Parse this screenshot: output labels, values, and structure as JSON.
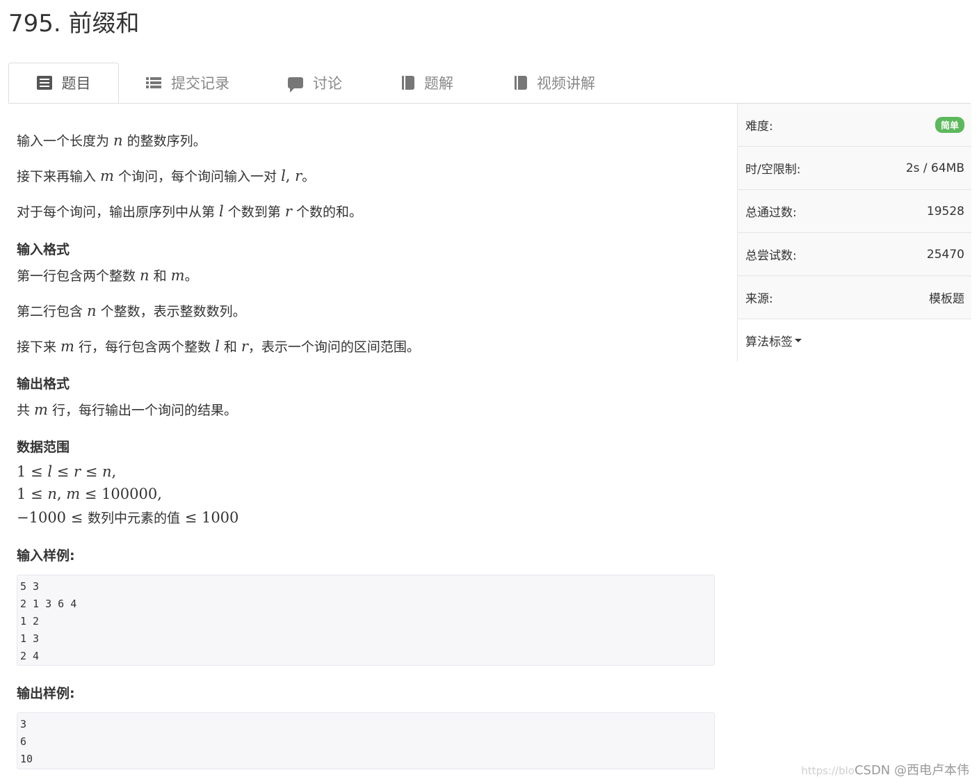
{
  "problem": {
    "title": "795. 前缀和"
  },
  "tabs": [
    {
      "label": "题目",
      "icon": "file-text-icon",
      "active": true
    },
    {
      "label": "提交记录",
      "icon": "list-icon"
    },
    {
      "label": "讨论",
      "icon": "comment-icon"
    },
    {
      "label": "题解",
      "icon": "book-icon"
    },
    {
      "label": "视频讲解",
      "icon": "book-icon"
    }
  ],
  "description": {
    "p1": {
      "a": "输入一个长度为 ",
      "v": "n",
      "b": " 的整数序列。"
    },
    "p2": {
      "a": "接下来再输入 ",
      "v1": "m",
      "b": " 个询问，每个询问输入一对 ",
      "v2": "l",
      "c": ", ",
      "v3": "r",
      "d": "。"
    },
    "p3": {
      "a": "对于每个询问，输出原序列中从第 ",
      "v1": "l",
      "b": " 个数到第 ",
      "v2": "r",
      "c": " 个数的和。"
    }
  },
  "input_format": {
    "heading": "输入格式",
    "l1": {
      "a": "第一行包含两个整数 ",
      "v1": "n",
      "b": " 和 ",
      "v2": "m",
      "c": "。"
    },
    "l2": {
      "a": "第二行包含 ",
      "v": "n",
      "b": " 个整数，表示整数数列。"
    },
    "l3": {
      "a": "接下来 ",
      "v1": "m",
      "b": " 行，每行包含两个整数 ",
      "v2": "l",
      "c": " 和 ",
      "v3": "r",
      "d": "，表示一个询问的区间范围。"
    }
  },
  "output_format": {
    "heading": "输出格式",
    "l1": {
      "a": "共 ",
      "v": "m",
      "b": " 行，每行输出一个询问的结果。"
    }
  },
  "data_range": {
    "heading": "数据范围",
    "r1": {
      "a": "1 ≤ ",
      "v1": "l",
      "b": " ≤ ",
      "v2": "r",
      "c": " ≤ ",
      "v3": "n",
      "d": ","
    },
    "r2": {
      "a": "1 ≤ ",
      "v1": "n",
      "b": ", ",
      "v2": "m",
      "c": " ≤ 100000,"
    },
    "r3": {
      "a": "−1000 ≤ ",
      "cn": "数列中元素的值",
      "b": " ≤ 1000"
    }
  },
  "sample_input": {
    "heading": "输入样例:",
    "lines": [
      "5 3",
      "2 1 3 6 4",
      "1 2",
      "1 3",
      "2 4"
    ]
  },
  "sample_output": {
    "heading": "输出样例:",
    "lines": [
      "3",
      "6",
      "10"
    ]
  },
  "sidebar": {
    "difficulty_label": "难度:",
    "difficulty_value": "简单",
    "difficulty_color": "#5cb85c",
    "limit_label": "时/空限制:",
    "limit_value": "2s / 64MB",
    "passed_label": "总通过数:",
    "passed_value": "19528",
    "tried_label": "总尝试数:",
    "tried_value": "25470",
    "source_label": "来源:",
    "source_value": "模板题",
    "tags_label": "算法标签"
  },
  "watermark": {
    "faint": "https://blo",
    "text": "CSDN @西电卢本伟"
  }
}
